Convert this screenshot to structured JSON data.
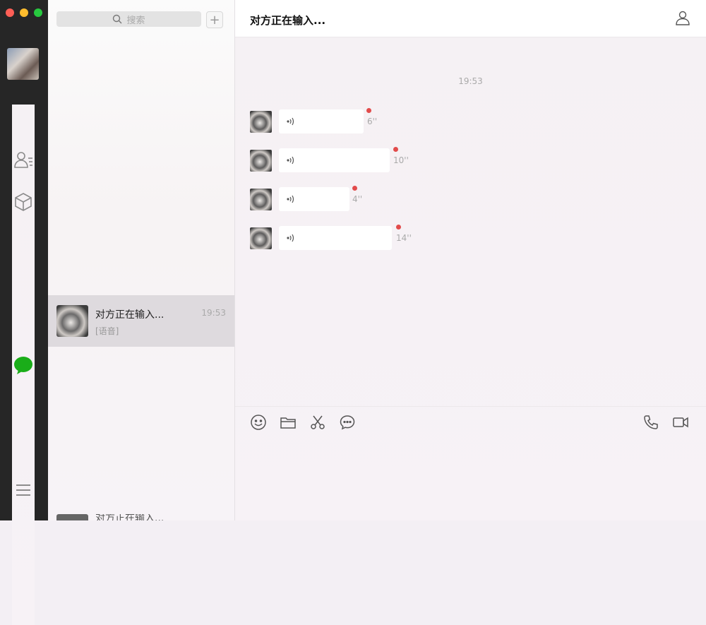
{
  "window": {
    "controls": [
      "close",
      "minimize",
      "zoom"
    ]
  },
  "sidebar": {
    "icons": [
      "profile-avatar",
      "chat-icon",
      "contacts-icon",
      "favorites-box-icon",
      "menu-icon"
    ],
    "accent": "#1aad19"
  },
  "conversation_list": {
    "search_placeholder": "搜索",
    "add_label": "+",
    "items": [
      {
        "name": "对方正在输入...",
        "preview": "[语音]",
        "time": "19:53"
      }
    ],
    "partial_item_name": "对方正在输入..."
  },
  "chat": {
    "title": "对方正在输入...",
    "timestamp": "19:53",
    "messages": [
      {
        "type": "voice",
        "duration": "6''",
        "unread": true
      },
      {
        "type": "voice",
        "duration": "10''",
        "unread": true
      },
      {
        "type": "voice",
        "duration": "4''",
        "unread": true
      },
      {
        "type": "voice",
        "duration": "14''",
        "unread": true
      }
    ],
    "toolbar": [
      "emoji-icon",
      "file-icon",
      "scissors-icon",
      "chat-history-icon"
    ],
    "toolbar_right": [
      "phone-icon",
      "video-icon"
    ]
  },
  "colors": {
    "unread_dot": "#e24b4b",
    "rail_bg": "#262626"
  }
}
